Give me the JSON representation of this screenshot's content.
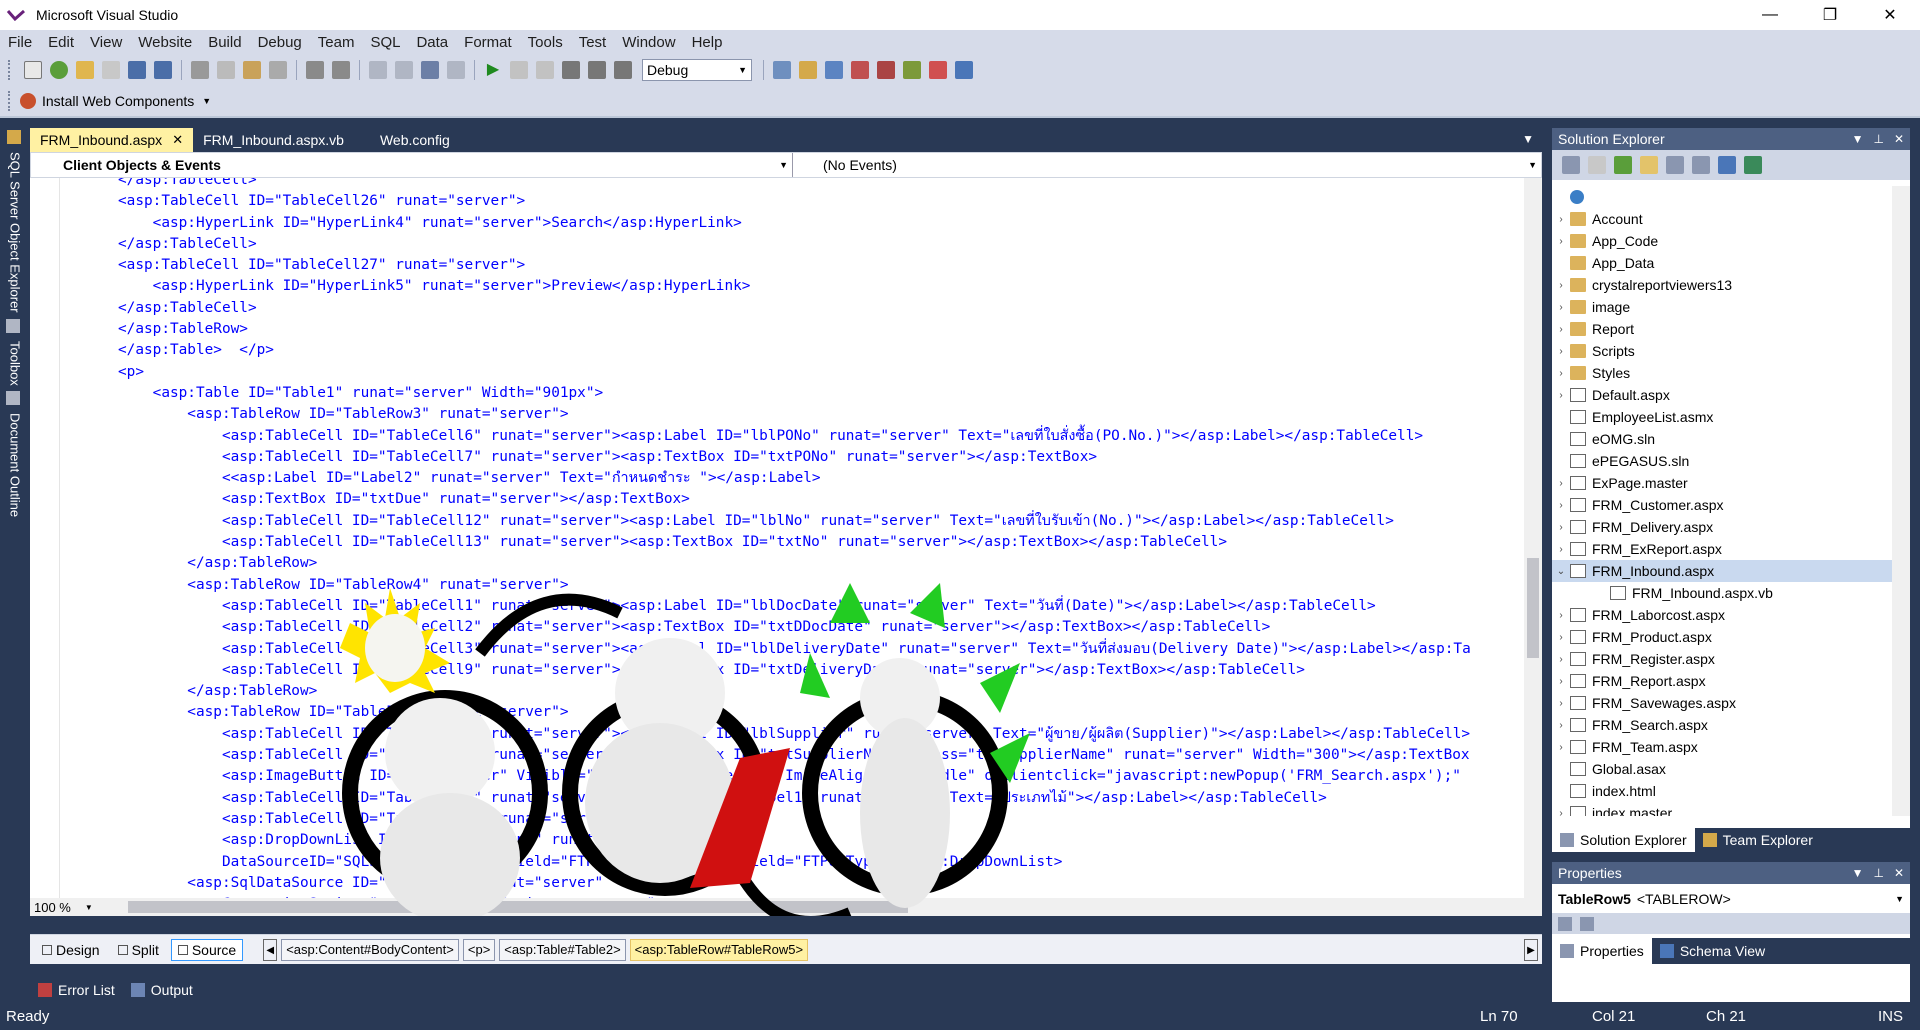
{
  "window": {
    "title": "Microsoft Visual Studio",
    "min": "—",
    "max": "❐",
    "close": "✕"
  },
  "menu": [
    "File",
    "Edit",
    "View",
    "Website",
    "Build",
    "Debug",
    "Team",
    "SQL",
    "Data",
    "Format",
    "Tools",
    "Test",
    "Window",
    "Help"
  ],
  "toolbar": {
    "config": "Debug",
    "install_label": "Install Web Components"
  },
  "sidebar": {
    "sql_label": "SQL Server Object Explorer",
    "toolbox_label": "Toolbox",
    "outline_label": "Document Outline"
  },
  "tabs": [
    {
      "label": "FRM_Inbound.aspx",
      "active": true
    },
    {
      "label": "FRM_Inbound.aspx.vb",
      "active": false
    },
    {
      "label": "Web.config",
      "active": false
    }
  ],
  "nav": {
    "left": "Client Objects & Events",
    "right": "(No Events)"
  },
  "editor": {
    "zoom": "100 %"
  },
  "views": {
    "design": "Design",
    "split": "Split",
    "source": "Source"
  },
  "crumbs": [
    "<asp:Content#BodyContent>",
    "<p>",
    "<asp:Table#Table2>",
    "<asp:TableRow#TableRow5>"
  ],
  "output_tabs": {
    "errors": "Error List",
    "output": "Output"
  },
  "status": {
    "ready": "Ready",
    "ln": "Ln 70",
    "col": "Col 21",
    "ch": "Ch 21",
    "ins": "INS"
  },
  "solution": {
    "title": "Solution Explorer",
    "items": [
      {
        "label": "Account",
        "type": "folder",
        "exp": "›"
      },
      {
        "label": "App_Code",
        "type": "folder",
        "exp": "›"
      },
      {
        "label": "App_Data",
        "type": "folder",
        "exp": ""
      },
      {
        "label": "crystalreportviewers13",
        "type": "folder",
        "exp": "›"
      },
      {
        "label": "image",
        "type": "folder",
        "exp": "›"
      },
      {
        "label": "Report",
        "type": "folder",
        "exp": "›"
      },
      {
        "label": "Scripts",
        "type": "folder",
        "exp": "›"
      },
      {
        "label": "Styles",
        "type": "folder",
        "exp": "›"
      },
      {
        "label": "Default.aspx",
        "type": "file",
        "exp": "›"
      },
      {
        "label": "EmployeeList.asmx",
        "type": "file",
        "exp": ""
      },
      {
        "label": "eOMG.sln",
        "type": "file",
        "exp": ""
      },
      {
        "label": "ePEGASUS.sln",
        "type": "file",
        "exp": ""
      },
      {
        "label": "ExPage.master",
        "type": "file",
        "exp": "›"
      },
      {
        "label": "FRM_Customer.aspx",
        "type": "file",
        "exp": "›"
      },
      {
        "label": "FRM_Delivery.aspx",
        "type": "file",
        "exp": "›"
      },
      {
        "label": "FRM_ExReport.aspx",
        "type": "file",
        "exp": "›"
      },
      {
        "label": "FRM_Inbound.aspx",
        "type": "file",
        "exp": "⌄",
        "selected": true
      },
      {
        "label": "FRM_Inbound.aspx.vb",
        "type": "file",
        "exp": "",
        "child": true
      },
      {
        "label": "FRM_Laborcost.aspx",
        "type": "file",
        "exp": "›"
      },
      {
        "label": "FRM_Product.aspx",
        "type": "file",
        "exp": "›"
      },
      {
        "label": "FRM_Register.aspx",
        "type": "file",
        "exp": "›"
      },
      {
        "label": "FRM_Report.aspx",
        "type": "file",
        "exp": "›"
      },
      {
        "label": "FRM_Savewages.aspx",
        "type": "file",
        "exp": "›"
      },
      {
        "label": "FRM_Search.aspx",
        "type": "file",
        "exp": "›"
      },
      {
        "label": "FRM_Team.aspx",
        "type": "file",
        "exp": "›"
      },
      {
        "label": "Global.asax",
        "type": "file",
        "exp": ""
      },
      {
        "label": "index.html",
        "type": "file",
        "exp": ""
      },
      {
        "label": "index.master",
        "type": "file",
        "exp": "›"
      }
    ],
    "tab_solution": "Solution Explorer",
    "tab_team": "Team Explorer"
  },
  "properties": {
    "title": "Properties",
    "object": "TableRow5",
    "type": "<TABLEROW>",
    "tab_props": "Properties",
    "tab_schema": "Schema View"
  },
  "code_lines": [
    "</asp:TableCell>",
    "<asp:TableCell ID=\"TableCell26\" runat=\"server\">",
    "    <asp:HyperLink ID=\"HyperLink4\" runat=\"server\">Search</asp:HyperLink>",
    "</asp:TableCell>",
    "<asp:TableCell ID=\"TableCell27\" runat=\"server\">",
    "    <asp:HyperLink ID=\"HyperLink5\" runat=\"server\">Preview</asp:HyperLink>",
    "</asp:TableCell>",
    "</asp:TableRow>",
    "</asp:Table>  </p>",
    "<p>",
    "    <asp:Table ID=\"Table1\" runat=\"server\" Width=\"901px\">",
    "        <asp:TableRow ID=\"TableRow3\" runat=\"server\">",
    "            <asp:TableCell ID=\"TableCell6\" runat=\"server\"><asp:Label ID=\"lblPONo\" runat=\"server\" Text=\"เลขที่ใบสั่งซื้อ(PO.No.)\"></asp:Label></asp:TableCell>",
    "            <asp:TableCell ID=\"TableCell7\" runat=\"server\"><asp:TextBox ID=\"txtPONo\" runat=\"server\"></asp:TextBox>",
    "            <<asp:Label ID=\"Label2\" runat=\"server\" Text=\"กำหนดชำระ \"></asp:Label>",
    "            <asp:TextBox ID=\"txtDue\" runat=\"server\"></asp:TextBox>",
    "            <asp:TableCell ID=\"TableCell12\" runat=\"server\"><asp:Label ID=\"lblNo\" runat=\"server\" Text=\"เลขที่ใบรับเข้า(No.)\"></asp:Label></asp:TableCell>",
    "            <asp:TableCell ID=\"TableCell13\" runat=\"server\"><asp:TextBox ID=\"txtNo\" runat=\"server\"></asp:TextBox></asp:TableCell>",
    "        </asp:TableRow>",
    "        <asp:TableRow ID=\"TableRow4\" runat=\"server\">",
    "            <asp:TableCell ID=\"TableCell1\" runat=\"server\"><asp:Label ID=\"lblDocDate\" runat=\"server\" Text=\"วันที่(Date)\"></asp:Label></asp:TableCell>",
    "            <asp:TableCell ID=\"TableCell2\" runat=\"server\"><asp:TextBox ID=\"txtDDocDate\" runat=\"server\"></asp:TextBox></asp:TableCell>",
    "            <asp:TableCell ID=\"TableCell3\" runat=\"server\"><asp:Label ID=\"lblDeliveryDate\" runat=\"server\" Text=\"วันที่ส่งมอบ(Delivery Date)\"></asp:Label></asp:Ta",
    "            <asp:TableCell ID=\"TableCell9\" runat=\"server\"><asp:TextBox ID=\"txtDeliveryDate\" runat=\"server\"></asp:TextBox></asp:TableCell>",
    "        </asp:TableRow>",
    "        <asp:TableRow ID=\"TableRow5\" runat=\"server\">",
    "            <asp:TableCell ID=\"TableCell4\" runat=\"server\"><asp:Label ID=\"lblSupplier\" runat=\"server\" Text=\"ผู้ขาย/ผู้ผลิต(Supplier)\"></asp:Label></asp:TableCell>",
    "            <asp:TableCell ID=\"TableCell5\" runat=\"server\"><asp:TextBox ID=\"txtSupplierName\" class=\"txtSupplierName\" runat=\"server\" Width=\"300\"></asp:TextBox",
    "            <asp:ImageButton ID=\"btnSupplier\" Visible=\"false\" runat=\"server\" ImageAlign=\"AbsMiddle\" onclientclick=\"javascript:newPopup('FRM_Search.aspx');\"",
    "            <asp:TableCell ID=\"TableCell8\" runat=\"server\"><asp:Label ID=\"Label1\" runat=\"server\" Text=\"ประเภทไม้\"></asp:Label></asp:TableCell>",
    "            <asp:TableCell ID=\"TableCell28\" runat=\"server\">",
    "            <asp:DropDownList ID=\"cboProductType\" runat=\"server\"",
    "            DataSourceID=\"SQLServer\" DataTextField=\"FTPdtType\" DataValueField=\"FTPdtType\"></asp:DropDownList>",
    "        <asp:SqlDataSource ID=\"SQLServer\" runat=\"server\"",
    "            ConnectionString=\"<%$ ConnectionStrings:constr %>\""
  ],
  "colors": {
    "chrome": "#293955",
    "menu": "#d6dbe9",
    "accent": "#fff1a3",
    "tag": "#0000ff",
    "element": "#a31515",
    "attr": "#ff0000"
  }
}
